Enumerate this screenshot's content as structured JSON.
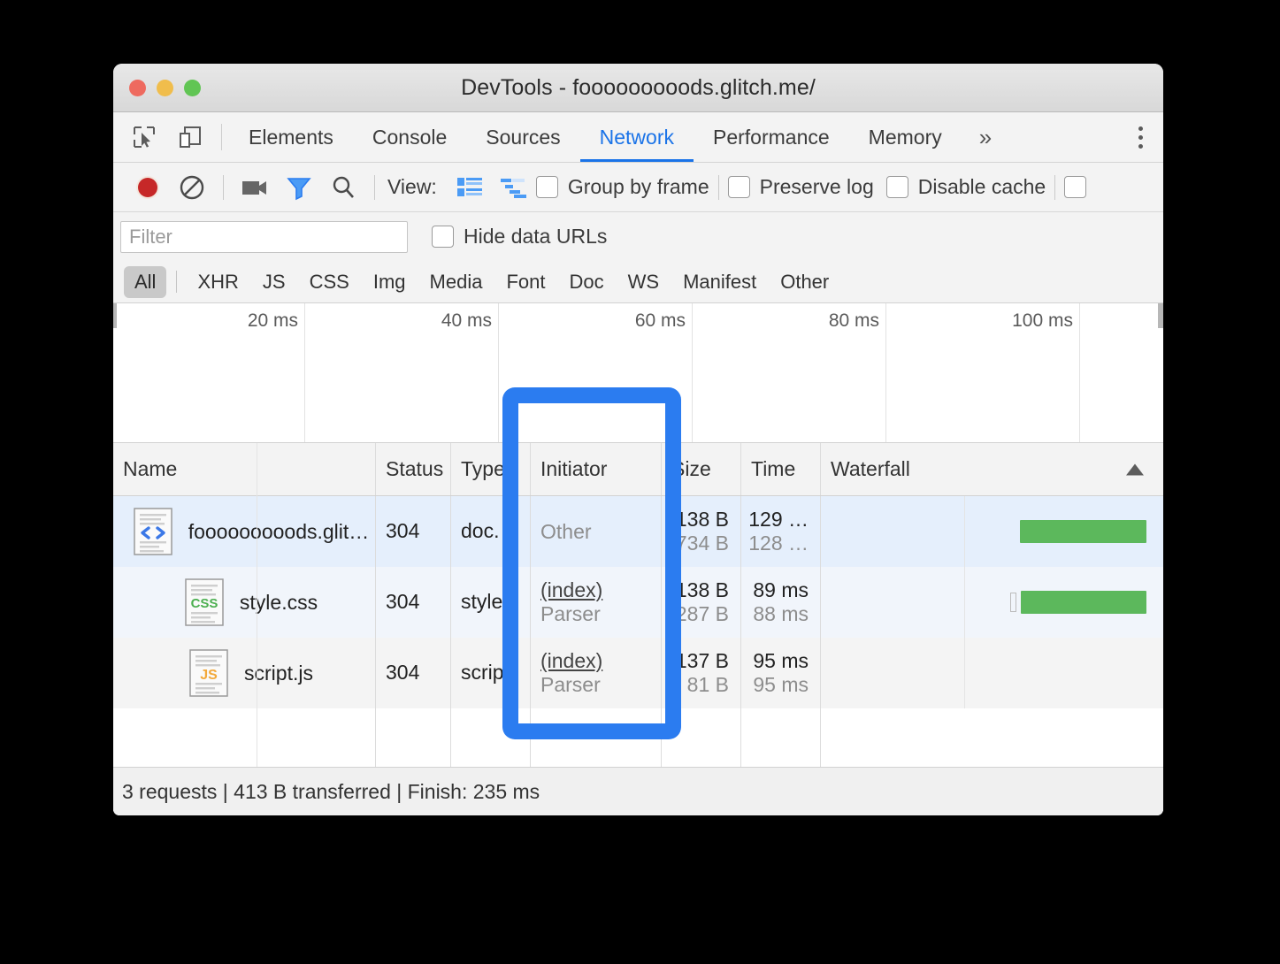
{
  "window": {
    "title": "DevTools - fooooooooods.glitch.me/",
    "traffic_lights": [
      "close",
      "minimize",
      "maximize"
    ]
  },
  "tabbar": {
    "left_icons": [
      "inspect-element-icon",
      "device-toolbar-icon"
    ],
    "tabs": [
      {
        "label": "Elements",
        "active": false
      },
      {
        "label": "Console",
        "active": false
      },
      {
        "label": "Sources",
        "active": false
      },
      {
        "label": "Network",
        "active": true
      },
      {
        "label": "Performance",
        "active": false
      },
      {
        "label": "Memory",
        "active": false
      }
    ],
    "more_label": "»",
    "menu_icon": "kebab-menu-icon"
  },
  "toolbar": {
    "icons": [
      "record-icon",
      "clear-icon",
      "screenshot-camera-icon",
      "filter-icon",
      "search-icon"
    ],
    "view_label": "View:",
    "view_icons": [
      "list-view-icon",
      "waterfall-view-icon"
    ],
    "checkboxes": [
      {
        "label": "Group by frame",
        "checked": false
      },
      {
        "label": "Preserve log",
        "checked": false
      },
      {
        "label": "Disable cache",
        "checked": false
      },
      {
        "label": "",
        "checked": false
      }
    ]
  },
  "filterbar": {
    "filter_placeholder": "Filter",
    "filter_value": "",
    "hide_data_urls_label": "Hide data URLs",
    "hide_data_urls_checked": false
  },
  "type_filters": {
    "items": [
      "All",
      "XHR",
      "JS",
      "CSS",
      "Img",
      "Media",
      "Font",
      "Doc",
      "WS",
      "Manifest",
      "Other"
    ],
    "selected": "All"
  },
  "overview": {
    "ticks": [
      "20 ms",
      "40 ms",
      "60 ms",
      "80 ms",
      "100 ms"
    ]
  },
  "table": {
    "columns": [
      "Name",
      "Status",
      "Type",
      "Initiator",
      "Size",
      "Time",
      "Waterfall"
    ],
    "sort_column": "Waterfall",
    "sort_direction": "asc",
    "rows": [
      {
        "icon": "html-document-icon",
        "name": "fooooooooods.glit…",
        "status": "304",
        "type": "doc.",
        "initiator_main": "Other",
        "initiator_sub": "",
        "initiator_is_link": false,
        "size_main": "138 B",
        "size_sub": "734 B",
        "time_main": "129 …",
        "time_sub": "128 …",
        "selected": true
      },
      {
        "icon": "css-document-icon",
        "name": "style.css",
        "status": "304",
        "type": "style",
        "initiator_main": "(index)",
        "initiator_sub": "Parser",
        "initiator_is_link": true,
        "size_main": "138 B",
        "size_sub": "287 B",
        "time_main": "89 ms",
        "time_sub": "88 ms",
        "selected": false
      },
      {
        "icon": "js-document-icon",
        "name": "script.js",
        "status": "304",
        "type": "scrip",
        "initiator_main": "(index)",
        "initiator_sub": "Parser",
        "initiator_is_link": true,
        "size_main": "137 B",
        "size_sub": "81 B",
        "time_main": "95 ms",
        "time_sub": "95 ms",
        "selected": false
      }
    ]
  },
  "statusbar": {
    "text": "3 requests | 413 B transferred | Finish: 235 ms"
  },
  "highlight": {
    "color": "#2b7cf0",
    "target_column": "Initiator"
  }
}
